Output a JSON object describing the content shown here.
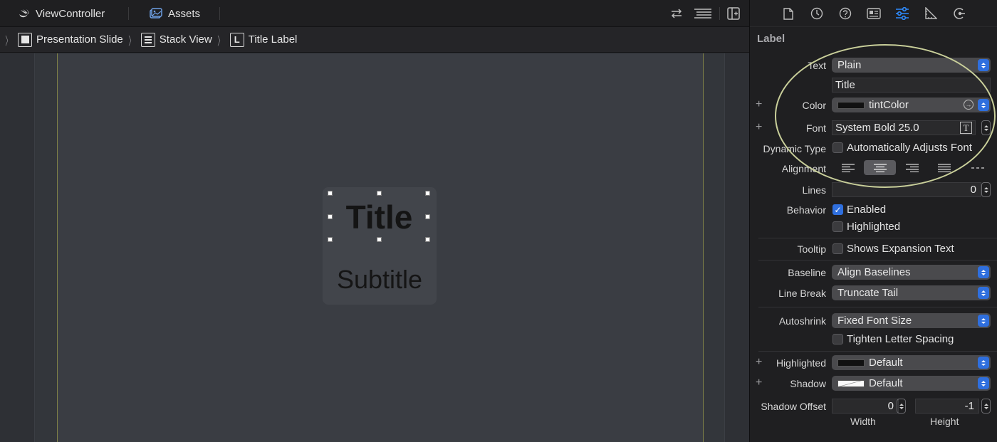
{
  "tabs": {
    "file_tab": "ViewController",
    "assets_tab": "Assets"
  },
  "breadcrumb": {
    "items": [
      "Presentation Slide",
      "Stack View",
      "Title Label"
    ],
    "label_badge": "L"
  },
  "canvas": {
    "title_text": "Title",
    "subtitle_text": "Subtitle"
  },
  "inspector": {
    "header": "Label",
    "text_label": "Text",
    "text_mode": "Plain",
    "text_value": "Title",
    "color_label": "Color",
    "color_value": "tintColor",
    "font_label": "Font",
    "font_value": "System Bold 25.0",
    "dynamic_type_label": "Dynamic Type",
    "dynamic_type_option": "Automatically Adjusts Font",
    "alignment_label": "Alignment",
    "lines_label": "Lines",
    "lines_value": "0",
    "behavior_label": "Behavior",
    "enabled_option": "Enabled",
    "highlighted_option": "Highlighted",
    "tooltip_label": "Tooltip",
    "tooltip_option": "Shows Expansion Text",
    "baseline_label": "Baseline",
    "baseline_value": "Align Baselines",
    "line_break_label": "Line Break",
    "line_break_value": "Truncate Tail",
    "autoshrink_label": "Autoshrink",
    "autoshrink_value": "Fixed Font Size",
    "tighten_option": "Tighten Letter Spacing",
    "highlighted_label": "Highlighted",
    "highlighted_value": "Default",
    "shadow_label": "Shadow",
    "shadow_value": "Default",
    "shadow_offset_label": "Shadow Offset",
    "shadow_width_value": "0",
    "shadow_height_value": "-1",
    "width_label": "Width",
    "height_label": "Height",
    "plus_sign": "+"
  },
  "colors": {
    "accent": "#2f6fde",
    "highlight_ring": "#c9cf9a"
  }
}
